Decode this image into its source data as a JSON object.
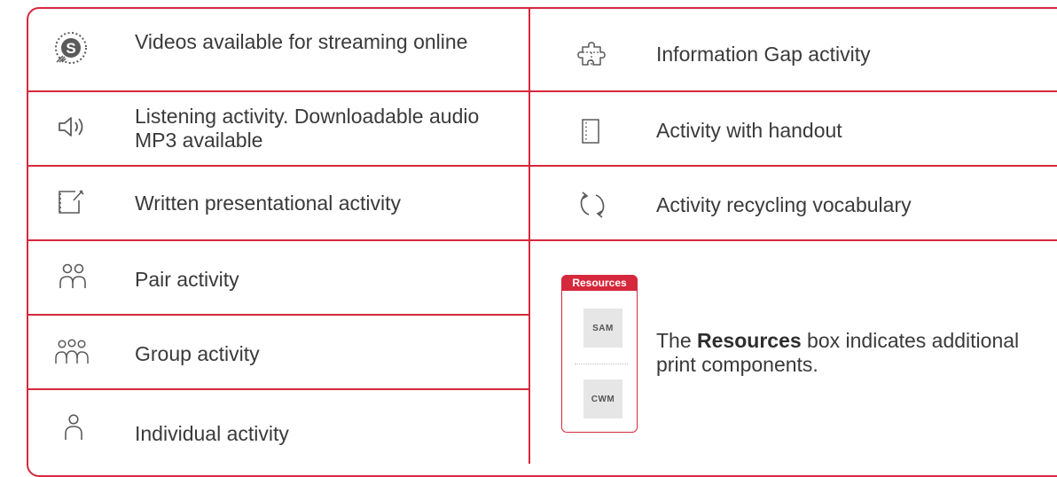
{
  "colors": {
    "accent": "#d6283c",
    "text": "#3a3a3a",
    "icon": "#5a5a5a"
  },
  "left_column": [
    {
      "icon": "streaming-video-icon",
      "text": "Videos available for streaming online"
    },
    {
      "icon": "audio-speaker-icon",
      "text": "Listening activity. Downloadable audio MP3 available"
    },
    {
      "icon": "written-presentation-icon",
      "text": "Written presentational activity"
    },
    {
      "icon": "pair-icon",
      "text": "Pair activity"
    },
    {
      "icon": "group-icon",
      "text": "Group activity"
    },
    {
      "icon": "individual-icon",
      "text": "Individual activity"
    }
  ],
  "right_column": [
    {
      "icon": "puzzle-icon",
      "text": "Information Gap activity"
    },
    {
      "icon": "handout-icon",
      "text": "Activity with handout"
    },
    {
      "icon": "recycle-icon",
      "text": "Activity recycling vocabulary"
    }
  ],
  "resources": {
    "tab_label": "Resources",
    "items": [
      "SAM",
      "CWM"
    ],
    "note_prefix": "The ",
    "note_bold": "Resources",
    "note_suffix": " box indicates additional print components."
  }
}
